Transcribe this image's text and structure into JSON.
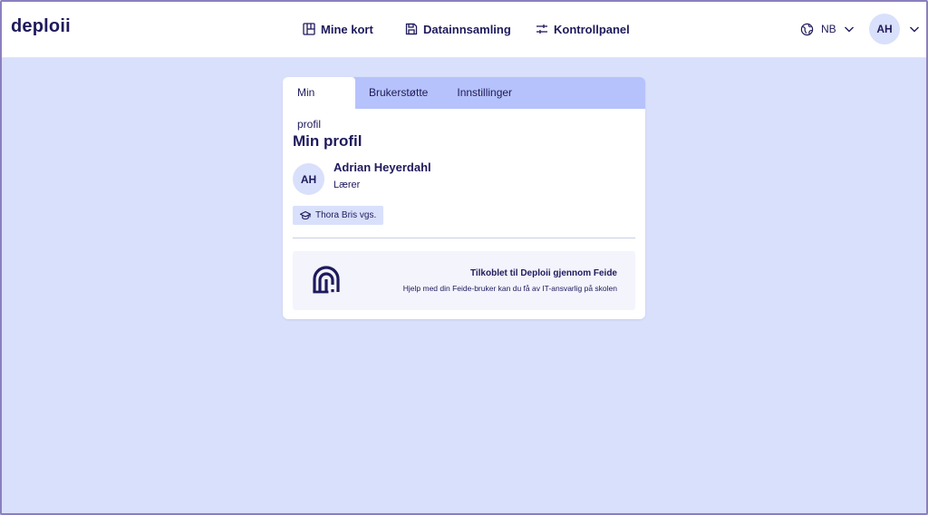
{
  "header": {
    "logo": "deploii",
    "nav": [
      {
        "label": "Mine kort",
        "icon": "cards-icon"
      },
      {
        "label": "Datainnsamling",
        "icon": "save-icon"
      },
      {
        "label": "Kontrollpanel",
        "icon": "sliders-icon"
      }
    ],
    "language": {
      "label": "NB",
      "icon": "globe-icon"
    },
    "user_initials": "AH"
  },
  "card": {
    "tabs": [
      {
        "label": "Min profil",
        "active": true
      },
      {
        "label": "Brukerstøtte",
        "active": false
      },
      {
        "label": "Innstillinger",
        "active": false
      }
    ],
    "title": "Min profil",
    "profile": {
      "initials": "AH",
      "name": "Adrian Heyerdahl",
      "role": "Lærer",
      "school": "Thora Bris vgs.",
      "school_icon": "graduation-cap-icon"
    },
    "feide": {
      "icon": "feide-icon",
      "title": "Tilkoblet til Deploii gjennom Feide",
      "subtitle": "Hjelp med din Feide-bruker kan du få av IT-ansvarlig på skolen"
    }
  },
  "colors": {
    "background": "#d9e0fb",
    "tab_bar": "#b6c2fb",
    "text": "#1f1a5c"
  }
}
